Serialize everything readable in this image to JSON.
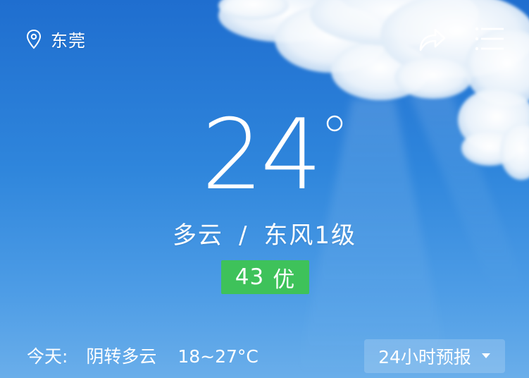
{
  "location": {
    "icon": "location-pin-icon",
    "name": "东莞"
  },
  "header": {
    "share_icon": "share-icon",
    "menu_icon": "menu-icon"
  },
  "current": {
    "temperature": "24",
    "degree_symbol": "°",
    "weather": "多云",
    "separator": "/",
    "wind": "东风1级"
  },
  "aqi": {
    "value": "43",
    "level": "优",
    "color": "#3ec25a"
  },
  "today": {
    "label": "今天:",
    "description": "阴转多云",
    "range": "18~27°C"
  },
  "forecast_button": {
    "label": "24小时预报",
    "icon": "caret-down-icon"
  },
  "colors": {
    "sky_top": "#1f6ecf",
    "sky_bottom": "#6aaeea"
  }
}
